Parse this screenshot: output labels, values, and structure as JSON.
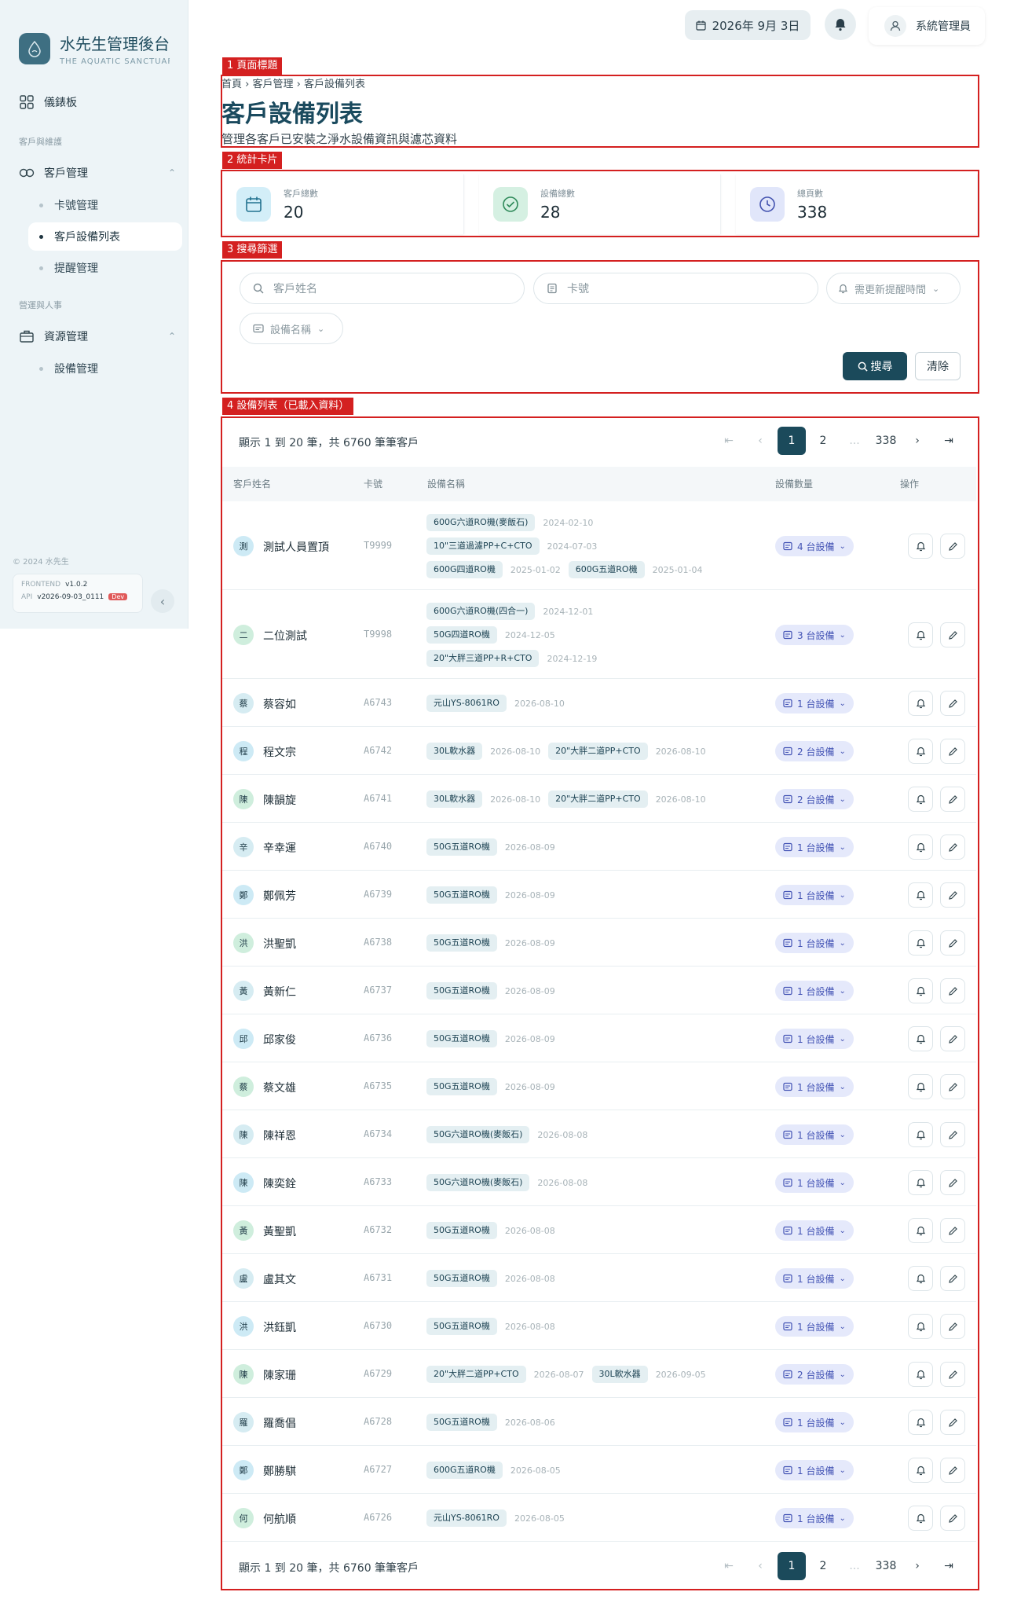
{
  "sidebar": {
    "brand_title": "水先生管理後台",
    "brand_sub": "THE AQUATIC SANCTUARY",
    "dashboard": "儀錶板",
    "section_customer": "客戶與維護",
    "customer_mgmt": "客戶管理",
    "sub_card": "卡號管理",
    "sub_equipment_list": "客戶設備列表",
    "sub_reminder": "提醒管理",
    "section_ops": "營運與人事",
    "resource_mgmt": "資源管理",
    "sub_equipment_mgmt": "設備管理",
    "copyright": "© 2024 水先生",
    "frontend_label": "FRONTEND",
    "frontend_version": "v1.0.2",
    "api_label": "API",
    "api_version": "v2026-09-03_0111",
    "env_badge": "Dev"
  },
  "header": {
    "date": "2026年 9月 3日",
    "user": "系統管理員"
  },
  "annotations": {
    "a1": "1 頁面標題",
    "a2": "2 統計卡片",
    "a3": "3 搜尋篩選",
    "a4": "4 設備列表（已載入資料）"
  },
  "page": {
    "crumb_home": "首頁",
    "crumb_customer": "客戶管理",
    "crumb_current": "客戶設備列表",
    "title": "客戶設備列表",
    "desc": "管理各客戶已安裝之淨水設備資訊與濾芯資料"
  },
  "stats": [
    {
      "label": "客戶總數",
      "value": "20"
    },
    {
      "label": "設備總數",
      "value": "28"
    },
    {
      "label": "總頁數",
      "value": "338"
    }
  ],
  "filters": {
    "customer_placeholder": "客戶姓名",
    "card_placeholder": "卡號",
    "reminder_label": "需更新提醒時間",
    "equipment_label": "設備名稱",
    "search": "搜尋",
    "clear": "清除"
  },
  "list": {
    "summary": "顯示 1 到 20 筆，共 6760 筆筆客戶",
    "pages": [
      "1",
      "2",
      "...",
      "338"
    ],
    "columns": [
      "客戶姓名",
      "卡號",
      "設備名稱",
      "設備數量",
      "操作"
    ]
  },
  "rows": [
    {
      "initial": "測",
      "name": "測試人員置頂",
      "card": "T9999",
      "count": "4 台設備",
      "equip": [
        [
          [
            "600G六道RO機(麥飯石)",
            "2024-02-10"
          ]
        ],
        [
          [
            "10\"三道過濾PP+C+CTO",
            "2024-07-03"
          ]
        ],
        [
          [
            "600G四道RO機",
            "2025-01-02"
          ],
          [
            "600G五道RO機",
            "2025-01-04"
          ]
        ]
      ]
    },
    {
      "initial": "二",
      "name": "二位測試",
      "card": "T9998",
      "count": "3 台設備",
      "equip": [
        [
          [
            "600G六道RO機(四合一)",
            "2024-12-01"
          ]
        ],
        [
          [
            "50G四道RO機",
            "2024-12-05"
          ]
        ],
        [
          [
            "20\"大胖三道PP+R+CTO",
            "2024-12-19"
          ]
        ]
      ]
    },
    {
      "initial": "蔡",
      "name": "蔡容如",
      "card": "A6743",
      "count": "1 台設備",
      "equip": [
        [
          [
            "元山YS-8061RO",
            "2026-08-10"
          ]
        ]
      ]
    },
    {
      "initial": "程",
      "name": "程文宗",
      "card": "A6742",
      "count": "2 台設備",
      "equip": [
        [
          [
            "30L軟水器",
            "2026-08-10"
          ],
          [
            "20\"大胖二道PP+CTO",
            "2026-08-10"
          ]
        ]
      ]
    },
    {
      "initial": "陳",
      "name": "陳韻旋",
      "card": "A6741",
      "count": "2 台設備",
      "equip": [
        [
          [
            "30L軟水器",
            "2026-08-10"
          ],
          [
            "20\"大胖二道PP+CTO",
            "2026-08-10"
          ]
        ]
      ]
    },
    {
      "initial": "辛",
      "name": "辛幸運",
      "card": "A6740",
      "count": "1 台設備",
      "equip": [
        [
          [
            "50G五道RO機",
            "2026-08-09"
          ]
        ]
      ]
    },
    {
      "initial": "鄭",
      "name": "鄭佩芳",
      "card": "A6739",
      "count": "1 台設備",
      "equip": [
        [
          [
            "50G五道RO機",
            "2026-08-09"
          ]
        ]
      ]
    },
    {
      "initial": "洪",
      "name": "洪聖凱",
      "card": "A6738",
      "count": "1 台設備",
      "equip": [
        [
          [
            "50G五道RO機",
            "2026-08-09"
          ]
        ]
      ]
    },
    {
      "initial": "黃",
      "name": "黃新仁",
      "card": "A6737",
      "count": "1 台設備",
      "equip": [
        [
          [
            "50G五道RO機",
            "2026-08-09"
          ]
        ]
      ]
    },
    {
      "initial": "邱",
      "name": "邱家俊",
      "card": "A6736",
      "count": "1 台設備",
      "equip": [
        [
          [
            "50G五道RO機",
            "2026-08-09"
          ]
        ]
      ]
    },
    {
      "initial": "蔡",
      "name": "蔡文雄",
      "card": "A6735",
      "count": "1 台設備",
      "equip": [
        [
          [
            "50G五道RO機",
            "2026-08-09"
          ]
        ]
      ]
    },
    {
      "initial": "陳",
      "name": "陳祥恩",
      "card": "A6734",
      "count": "1 台設備",
      "equip": [
        [
          [
            "50G六道RO機(麥飯石)",
            "2026-08-08"
          ]
        ]
      ]
    },
    {
      "initial": "陳",
      "name": "陳奕銓",
      "card": "A6733",
      "count": "1 台設備",
      "equip": [
        [
          [
            "50G六道RO機(麥飯石)",
            "2026-08-08"
          ]
        ]
      ]
    },
    {
      "initial": "黃",
      "name": "黃聖凱",
      "card": "A6732",
      "count": "1 台設備",
      "equip": [
        [
          [
            "50G五道RO機",
            "2026-08-08"
          ]
        ]
      ]
    },
    {
      "initial": "盧",
      "name": "盧其文",
      "card": "A6731",
      "count": "1 台設備",
      "equip": [
        [
          [
            "50G五道RO機",
            "2026-08-08"
          ]
        ]
      ]
    },
    {
      "initial": "洪",
      "name": "洪鈺凱",
      "card": "A6730",
      "count": "1 台設備",
      "equip": [
        [
          [
            "50G五道RO機",
            "2026-08-08"
          ]
        ]
      ]
    },
    {
      "initial": "陳",
      "name": "陳家珊",
      "card": "A6729",
      "count": "2 台設備",
      "equip": [
        [
          [
            "20\"大胖二道PP+CTO",
            "2026-08-07"
          ],
          [
            "30L軟水器",
            "2026-09-05"
          ]
        ]
      ]
    },
    {
      "initial": "羅",
      "name": "羅喬倡",
      "card": "A6728",
      "count": "1 台設備",
      "equip": [
        [
          [
            "50G五道RO機",
            "2026-08-06"
          ]
        ]
      ]
    },
    {
      "initial": "鄭",
      "name": "鄭勝騏",
      "card": "A6727",
      "count": "1 台設備",
      "equip": [
        [
          [
            "600G五道RO機",
            "2026-08-05"
          ]
        ]
      ]
    },
    {
      "initial": "何",
      "name": "何航順",
      "card": "A6726",
      "count": "1 台設備",
      "equip": [
        [
          [
            "元山YS-8061RO",
            "2026-08-05"
          ]
        ]
      ]
    }
  ],
  "colors": {
    "primary": "#1b4a5b",
    "annotation": "#d42020",
    "count_pill": "#e5e9fb"
  }
}
